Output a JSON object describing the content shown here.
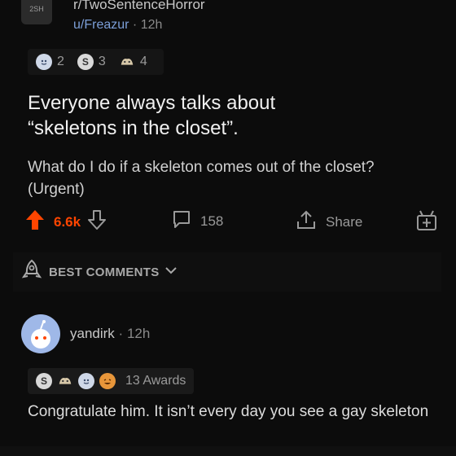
{
  "post": {
    "subreddit": "r/TwoSentenceHorror",
    "subreddit_avatar": "2SH",
    "author": "u/Freazur",
    "age": "12h",
    "awards": [
      {
        "icon": "helpful-award-icon",
        "count": "2"
      },
      {
        "icon": "silver-award-icon",
        "count": "3"
      },
      {
        "icon": "wholesome-award-icon",
        "count": "4"
      }
    ],
    "title_line1": "Everyone always talks about",
    "title_line2": "“skeletons in the closet”.",
    "body": "What do I do if a skeleton comes out of the closet? (Urgent)",
    "score": "6.6k",
    "comments": "158",
    "share_label": "Share"
  },
  "sort": {
    "label": "BEST COMMENTS"
  },
  "comment": {
    "author": "yandirk",
    "age": "12h",
    "awards_label": "13 Awards",
    "body": "Congratulate him. It isn’t every day you see a gay skeleton"
  },
  "colors": {
    "background": "#0c0c0c",
    "upvote": "#ff4500",
    "user_link": "#7c9fd8",
    "avatar": "#9fb8e8"
  }
}
